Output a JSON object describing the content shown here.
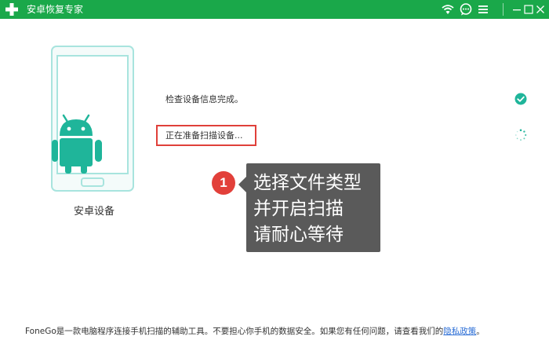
{
  "window": {
    "title": "安卓恢复专家",
    "icons": [
      "app-plus-logo",
      "wifi-icon",
      "chat-icon",
      "menu-icon",
      "minimize-icon",
      "maximize-icon",
      "close-icon"
    ]
  },
  "colors": {
    "titlebar": "#1aa84a",
    "accent_teal": "#1fb59a",
    "phone_frame": "#a8e4de",
    "highlight_red": "#e0403a",
    "callout_bg": "#5a5a5a"
  },
  "device": {
    "label": "安卓设备"
  },
  "steps": [
    {
      "text": "检查设备信息完成。",
      "status": "done"
    },
    {
      "text": "正在准备扫描设备...",
      "status": "loading"
    }
  ],
  "annotation": {
    "badge": "1",
    "lines": [
      "选择文件类型",
      "并开启扫描",
      "请耐心等待"
    ]
  },
  "footer": {
    "text": "FoneGo是一款电脑程序连接手机扫描的辅助工具。不要担心你手机的数据安全。如果您有任何问题，请查看我们的",
    "link_text": "隐私政策",
    "trailing": "。"
  }
}
